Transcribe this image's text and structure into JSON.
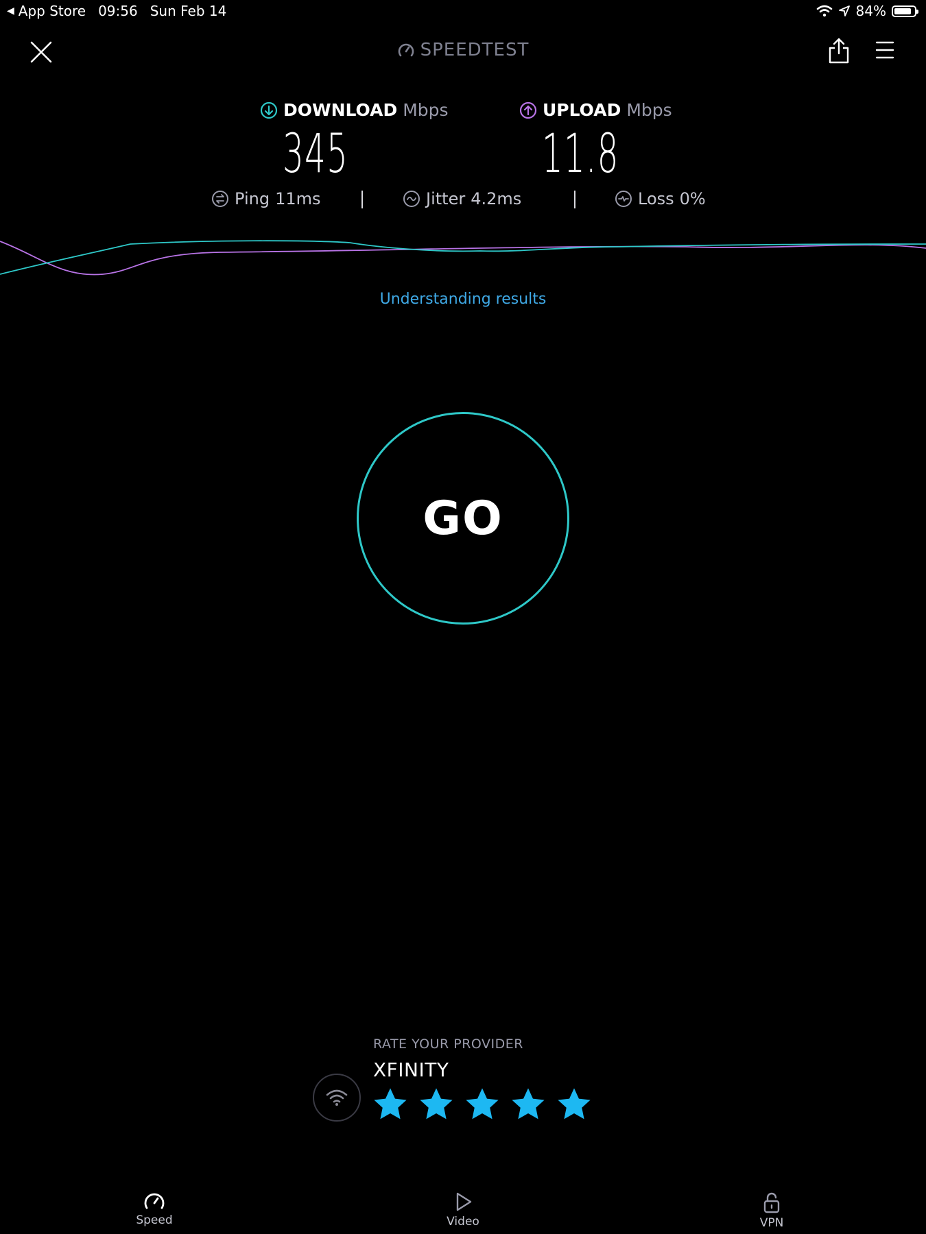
{
  "status_bar": {
    "back_app": "App Store",
    "time": "09:56",
    "date": "Sun Feb 14",
    "battery": "84%",
    "battery_level": 0.84
  },
  "header": {
    "brand": "SPEEDTEST",
    "icons": [
      "close-icon",
      "speedometer-icon",
      "share-icon",
      "menu-icon"
    ]
  },
  "results": {
    "download": {
      "label": "DOWNLOAD",
      "unit": "Mbps",
      "value": "345",
      "icon": "download-arrow-icon",
      "color": "#2ec8c8"
    },
    "upload": {
      "label": "UPLOAD",
      "unit": "Mbps",
      "value": "11.8",
      "icon": "upload-arrow-icon",
      "color": "#b873e6"
    },
    "ping": {
      "label": "Ping",
      "value": "11ms"
    },
    "jitter": {
      "label": "Jitter",
      "value": "4.2ms"
    },
    "loss": {
      "label": "Loss",
      "value": "0%"
    }
  },
  "colors": {
    "download": "#2ec8c8",
    "upload": "#b873e6",
    "link": "#3fa9e6",
    "star": "#1db8f2"
  },
  "links": {
    "understanding": "Understanding results"
  },
  "go_button": {
    "label": "GO"
  },
  "provider": {
    "prompt": "RATE YOUR PROVIDER",
    "name": "XFINITY",
    "rating": 5,
    "max_rating": 5
  },
  "tabs": [
    {
      "label": "Speed",
      "icon": "speedometer-icon",
      "active": true
    },
    {
      "label": "Video",
      "icon": "play-icon",
      "active": false
    },
    {
      "label": "VPN",
      "icon": "lock-icon",
      "active": false
    }
  ]
}
